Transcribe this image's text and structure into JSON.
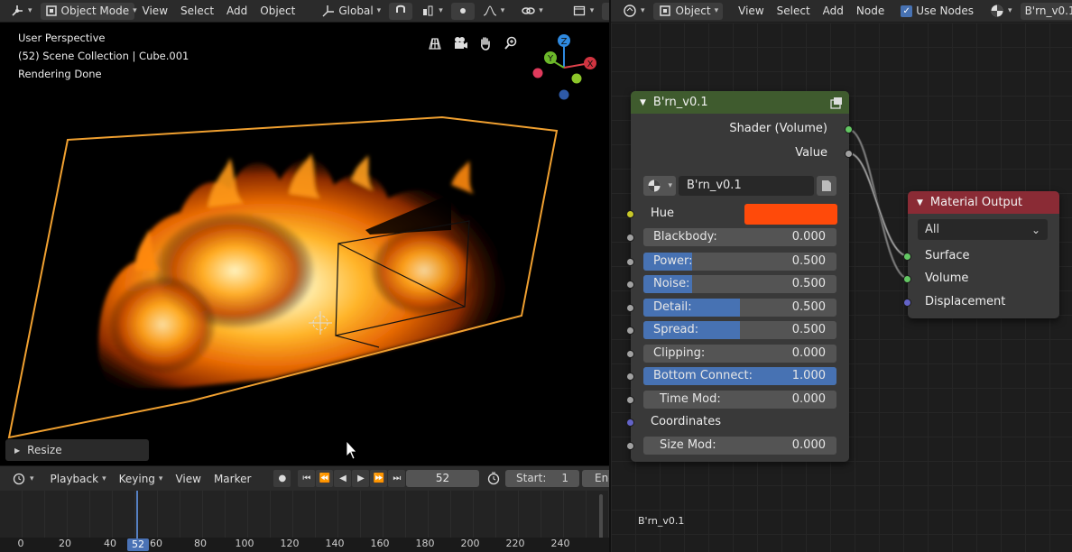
{
  "viewport": {
    "header": {
      "mode_label": "Object Mode",
      "menus": [
        "View",
        "Select",
        "Add",
        "Object"
      ],
      "orientation_label": "Global"
    },
    "info": {
      "perspective": "User Perspective",
      "collection": "(52) Scene Collection | Cube.001",
      "status": "Rendering Done"
    },
    "gizmo": {
      "z": "Z",
      "y": "Y",
      "x": "X"
    },
    "resize_panel": {
      "label": "Resize"
    }
  },
  "timeline": {
    "menus": {
      "playback": "Playback",
      "keying": "Keying",
      "view": "View",
      "marker": "Marker"
    },
    "current_frame": "52",
    "start_label": "Start:",
    "start_value": "1",
    "end_label": "End",
    "ruler": [
      "0",
      "20",
      "40",
      "60",
      "80",
      "100",
      "120",
      "140",
      "160",
      "180",
      "200",
      "220",
      "240"
    ],
    "current_marker": "52"
  },
  "node_editor": {
    "header": {
      "type_label": "Object",
      "menus": [
        "View",
        "Select",
        "Add",
        "Node"
      ],
      "use_nodes_label": "Use Nodes",
      "material_name": "B'rn_v0.1"
    },
    "group_node": {
      "title": "B'rn_v0.1",
      "outputs": [
        "Shader (Volume)",
        "Value"
      ],
      "datablock_name": "B'rn_v0.1",
      "hue_label": "Hue",
      "hue_color": "#ff4a0a",
      "fields": [
        {
          "label": "Blackbody:",
          "value": "0.000",
          "fill": 0.0
        },
        {
          "label": "Power:",
          "value": "0.500",
          "fill": 0.25
        },
        {
          "label": "Noise:",
          "value": "0.500",
          "fill": 0.25
        },
        {
          "label": "Detail:",
          "value": "0.500",
          "fill": 0.5
        },
        {
          "label": "Spread:",
          "value": "0.500",
          "fill": 0.5
        },
        {
          "label": "Clipping:",
          "value": "0.000",
          "fill": 0.0
        },
        {
          "label": "Bottom Connect:",
          "value": "1.000",
          "fill": 1.0
        },
        {
          "label": "Time Mod:",
          "value": "0.000",
          "fill": 0.0
        }
      ],
      "coordinates_label": "Coordinates",
      "size_mod": {
        "label": "Size Mod:",
        "value": "0.000"
      }
    },
    "output_node": {
      "title": "Material Output",
      "target": "All",
      "inputs": [
        "Surface",
        "Volume",
        "Displacement"
      ]
    },
    "frame_label": "B'rn_v0.1"
  },
  "colors": {
    "group_header": "#3f5b2e",
    "output_header": "#8a2b35",
    "shader_socket": "#63c763",
    "value_socket": "#a1a1a1",
    "color_socket": "#c7c729",
    "vector_socket": "#6363c7",
    "accent_blue": "#4772b3",
    "selection_orange": "#f0a030"
  }
}
